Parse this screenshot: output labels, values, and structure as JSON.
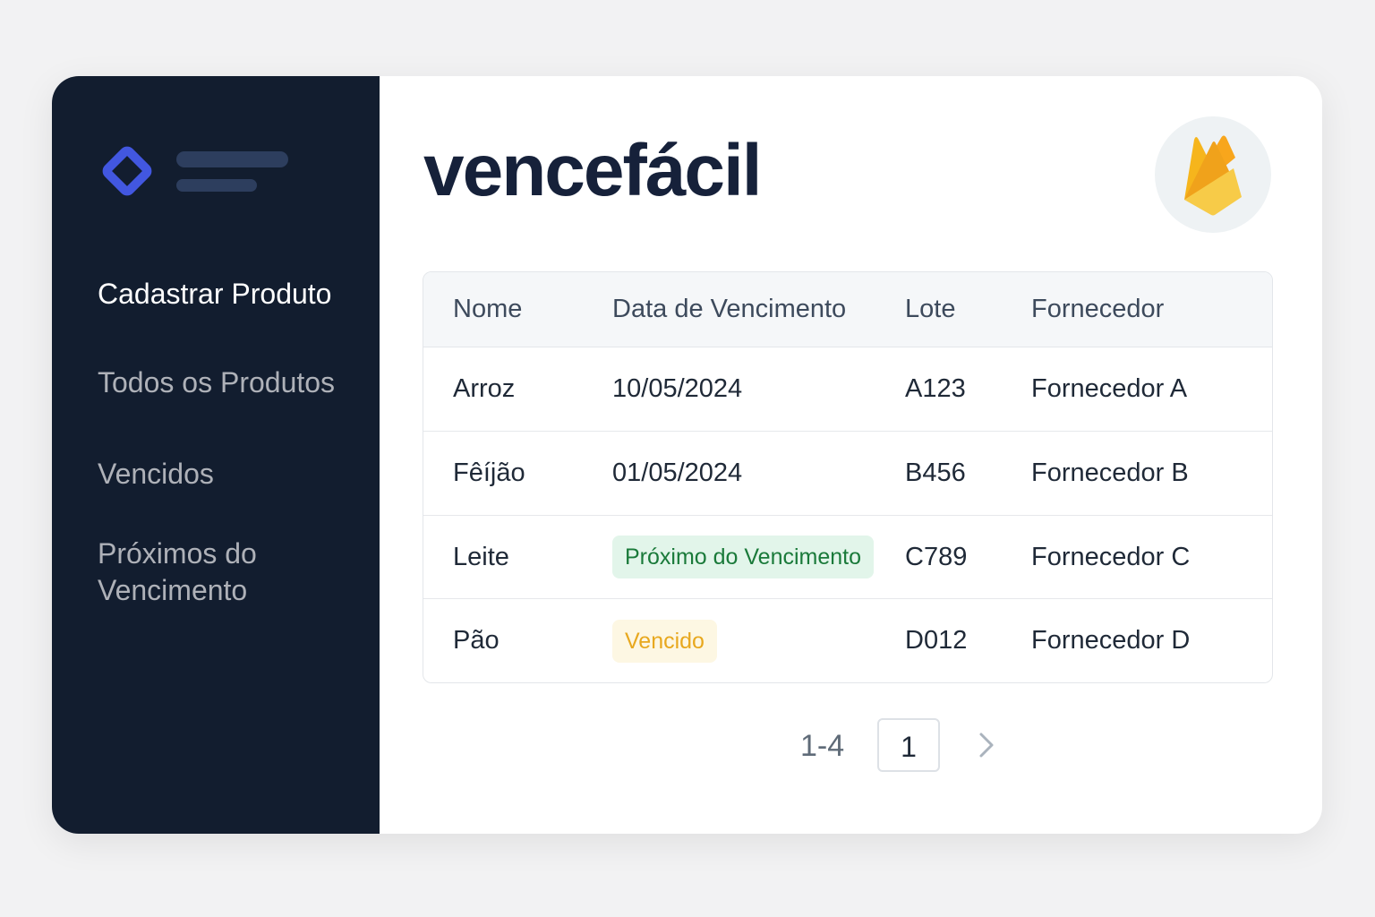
{
  "sidebar": {
    "logo_icon": "diamond-logo-icon",
    "items": [
      {
        "label": "Cadastrar Produto",
        "active": true
      },
      {
        "label": "Todos os Produtos",
        "active": false
      },
      {
        "label": "Vencidos",
        "active": false
      },
      {
        "label": "Próximos do Vencimento",
        "active": false
      }
    ]
  },
  "header": {
    "brand": "vencefácil",
    "badge_icon": "firebase-flame-icon"
  },
  "table": {
    "columns": [
      "Nome",
      "Data de Vencimento",
      "Lote",
      "Fornecedor"
    ],
    "rows": [
      {
        "nome": "Arroz",
        "data": "10/05/2024",
        "lote": "A123",
        "fornecedor": "Fornecedor A"
      },
      {
        "nome": "Fêíjão",
        "data": "01/05/2024",
        "lote": "B456",
        "fornecedor": "Fornecedor B"
      },
      {
        "nome": "Leite",
        "data": "Próximo do Vencimento",
        "lote": "C789",
        "fornecedor": "Fornecedor C"
      },
      {
        "nome": "Pão",
        "data": "Vencido",
        "lote": "D012",
        "fornecedor": "Fornecedor D"
      }
    ]
  },
  "pagination": {
    "range": "1-4",
    "current_page": "1",
    "next_icon": "chevron-right-icon"
  },
  "colors": {
    "sidebar_bg": "#121d2f",
    "accent": "#4257e0",
    "status_near": "#1a7a3a",
    "status_expired": "#e8a81e"
  }
}
